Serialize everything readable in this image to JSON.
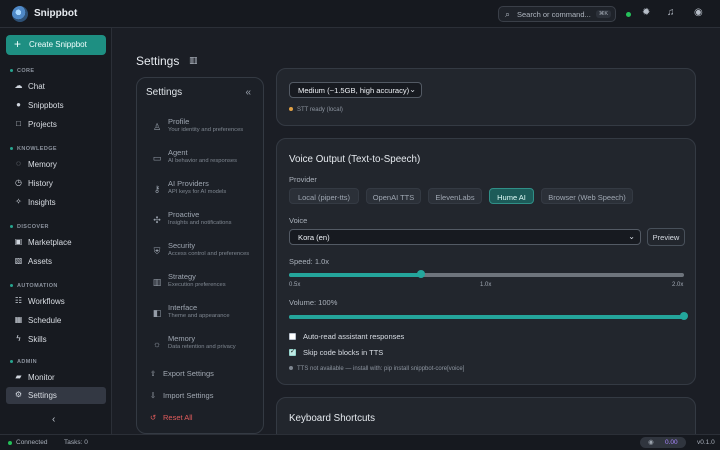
{
  "app": {
    "name": "Snippbot"
  },
  "topbar": {
    "search_placeholder": "Search or command...",
    "shortcut": "⌘K"
  },
  "sidebar": {
    "create_label": "Create Snippbot",
    "sections": {
      "core": "CORE",
      "knowledge": "KNOWLEDGE",
      "discover": "DISCOVER",
      "automation": "AUTOMATION",
      "admin": "ADMIN"
    },
    "items": [
      {
        "label": "Chat",
        "icon": "chat-icon"
      },
      {
        "label": "Snippbots",
        "icon": "user-icon"
      },
      {
        "label": "Projects",
        "icon": "square-icon"
      },
      {
        "label": "Memory",
        "icon": "memory-icon"
      },
      {
        "label": "History",
        "icon": "clock-icon"
      },
      {
        "label": "Insights",
        "icon": "spark-icon"
      },
      {
        "label": "Marketplace",
        "icon": "store-icon"
      },
      {
        "label": "Assets",
        "icon": "image-icon"
      },
      {
        "label": "Workflows",
        "icon": "workflow-icon"
      },
      {
        "label": "Schedule",
        "icon": "calendar-icon"
      },
      {
        "label": "Skills",
        "icon": "lightning-icon"
      },
      {
        "label": "Monitor",
        "icon": "monitor-icon"
      },
      {
        "label": "Settings",
        "icon": "gear-icon",
        "active": true
      }
    ]
  },
  "page": {
    "title": "Settings"
  },
  "settings_nav": {
    "title": "Settings",
    "items": [
      {
        "title": "Profile",
        "subtitle": "Your identity and preferences"
      },
      {
        "title": "Agent",
        "subtitle": "AI behavior and responses"
      },
      {
        "title": "AI Providers",
        "subtitle": "API keys for AI models"
      },
      {
        "title": "Proactive",
        "subtitle": "Insights and notifications"
      },
      {
        "title": "Security",
        "subtitle": "Access control and preferences"
      },
      {
        "title": "Strategy",
        "subtitle": "Execution preferences"
      },
      {
        "title": "Interface",
        "subtitle": "Theme and appearance"
      },
      {
        "title": "Memory",
        "subtitle": "Data retention and privacy"
      }
    ],
    "actions": {
      "export": "Export Settings",
      "import": "Import Settings",
      "reset": "Reset All"
    }
  },
  "stt": {
    "model_value": "Medium (~1.5GB, high accuracy)",
    "status": "STT ready (local)"
  },
  "voice_output": {
    "title": "Voice Output (Text-to-Speech)",
    "provider_label": "Provider",
    "providers": [
      "Local (piper-tts)",
      "OpenAI TTS",
      "ElevenLabs",
      "Hume AI",
      "Browser (Web Speech)"
    ],
    "selected_provider": "Hume AI",
    "voice_label": "Voice",
    "voice_value": "Kora (en)",
    "preview_label": "Preview",
    "speed_label": "Speed: 1.0x",
    "speed_value": 1.0,
    "speed_min": 0.5,
    "speed_max": 2.0,
    "speed_ticks": [
      "0.5x",
      "1.0x",
      "2.0x"
    ],
    "volume_label": "Volume: 100%",
    "volume_percent": 100,
    "auto_read_label": "Auto-read assistant responses",
    "auto_read_checked": false,
    "skip_code_label": "Skip code blocks in TTS",
    "skip_code_checked": true,
    "status": "TTS not available — install with: pip install snippbot-core[voice]"
  },
  "keyboard": {
    "title": "Keyboard Shortcuts"
  },
  "footer": {
    "connection": "Connected",
    "tasks_label": "Tasks:",
    "tasks_count": "0",
    "cost": "0.00",
    "version": "v0.1.0"
  },
  "colors": {
    "accent": "#1e8f82",
    "success": "#25c15b",
    "danger": "#e25c5c",
    "cost": "#a987ff"
  }
}
